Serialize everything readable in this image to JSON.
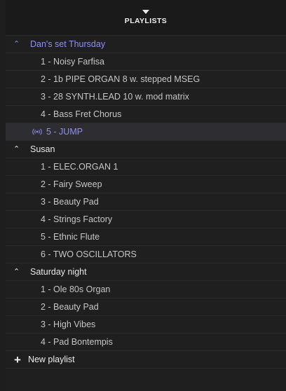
{
  "header": {
    "title": "PLAYLISTS"
  },
  "playlists": [
    {
      "name": "Dan's set Thursday",
      "active": true,
      "items": [
        {
          "label": "1 - Noisy Farfisa"
        },
        {
          "label": "2 - 1b  PIPE ORGAN 8 w. stepped MSEG"
        },
        {
          "label": "3 - 28  SYNTH.LEAD 10 w. mod matrix"
        },
        {
          "label": "4 - Bass Fret Chorus"
        },
        {
          "label": "5 - JUMP",
          "selected": true
        }
      ]
    },
    {
      "name": "Susan",
      "items": [
        {
          "label": "1 - ELEC.ORGAN 1"
        },
        {
          "label": "2 - Fairy Sweep"
        },
        {
          "label": "3 - Beauty Pad"
        },
        {
          "label": "4 - Strings Factory"
        },
        {
          "label": "5 - Ethnic Flute"
        },
        {
          "label": "6 - TWO OSCILLATORS"
        }
      ]
    },
    {
      "name": "Saturday night",
      "items": [
        {
          "label": "1 - Ole 80s Organ"
        },
        {
          "label": "2 - Beauty Pad"
        },
        {
          "label": "3 - High Vibes"
        },
        {
          "label": "4 - Pad Bontempis"
        }
      ]
    }
  ],
  "new_playlist": {
    "label": "New playlist"
  },
  "colors": {
    "accent": "#8f8ff0",
    "background": "#1f1f20",
    "selected_row": "#2e2e32"
  }
}
